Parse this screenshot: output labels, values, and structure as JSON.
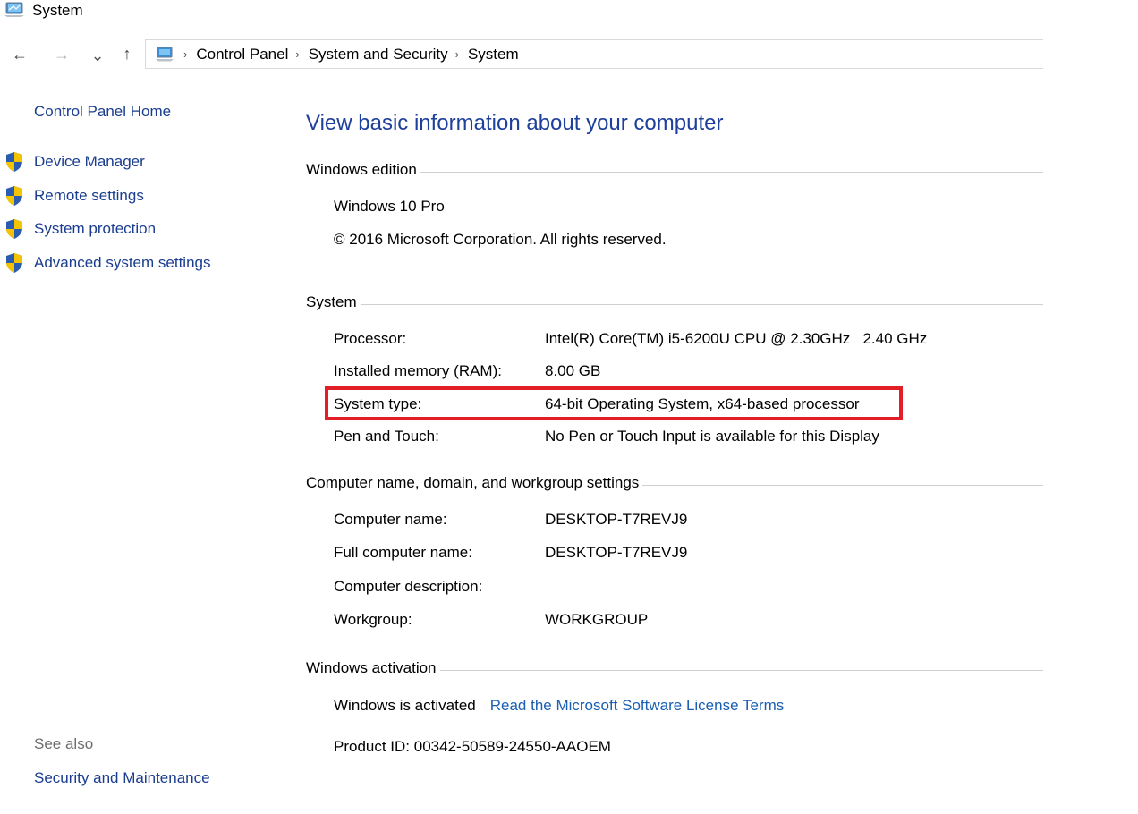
{
  "window": {
    "title": "System"
  },
  "nav": {
    "back": "←",
    "forward": "→",
    "recent": "⌄",
    "up": "↑"
  },
  "breadcrumb": [
    "Control Panel",
    "System and Security",
    "System"
  ],
  "left_pane": {
    "home_label": "Control Panel Home",
    "tasks": [
      "Device Manager",
      "Remote settings",
      "System protection",
      "Advanced system settings"
    ],
    "see_also_label": "See also",
    "see_also_links": [
      "Security and Maintenance"
    ]
  },
  "main": {
    "title": "View basic information about your computer",
    "edition": {
      "header": "Windows edition",
      "name": "Windows 10 Pro",
      "copyright": "© 2016 Microsoft Corporation. All rights reserved."
    },
    "system": {
      "header": "System",
      "rows": [
        {
          "label": "Processor:",
          "value": "Intel(R) Core(TM) i5-6200U CPU @ 2.30GHz   2.40 GHz"
        },
        {
          "label": "Installed memory (RAM):",
          "value": "8.00 GB"
        },
        {
          "label": "System type:",
          "value": "64-bit Operating System, x64-based processor"
        },
        {
          "label": "Pen and Touch:",
          "value": "No Pen or Touch Input is available for this Display"
        }
      ]
    },
    "computer_name": {
      "header": "Computer name, domain, and workgroup settings",
      "rows": [
        {
          "label": "Computer name:",
          "value": "DESKTOP-T7REVJ9"
        },
        {
          "label": "Full computer name:",
          "value": "DESKTOP-T7REVJ9"
        },
        {
          "label": "Computer description:",
          "value": ""
        },
        {
          "label": "Workgroup:",
          "value": "WORKGROUP"
        }
      ]
    },
    "activation": {
      "header": "Windows activation",
      "status": "Windows is activated",
      "license_link": "Read the Microsoft Software License Terms",
      "product_id": "Product ID: 00342-50589-24550-AAOEM"
    }
  },
  "colors": {
    "link": "#1a3d8f",
    "title": "#1e3f9b",
    "highlight": "#e21f26"
  },
  "icons": [
    "system-monitor-icon",
    "uac-shield-icon"
  ]
}
